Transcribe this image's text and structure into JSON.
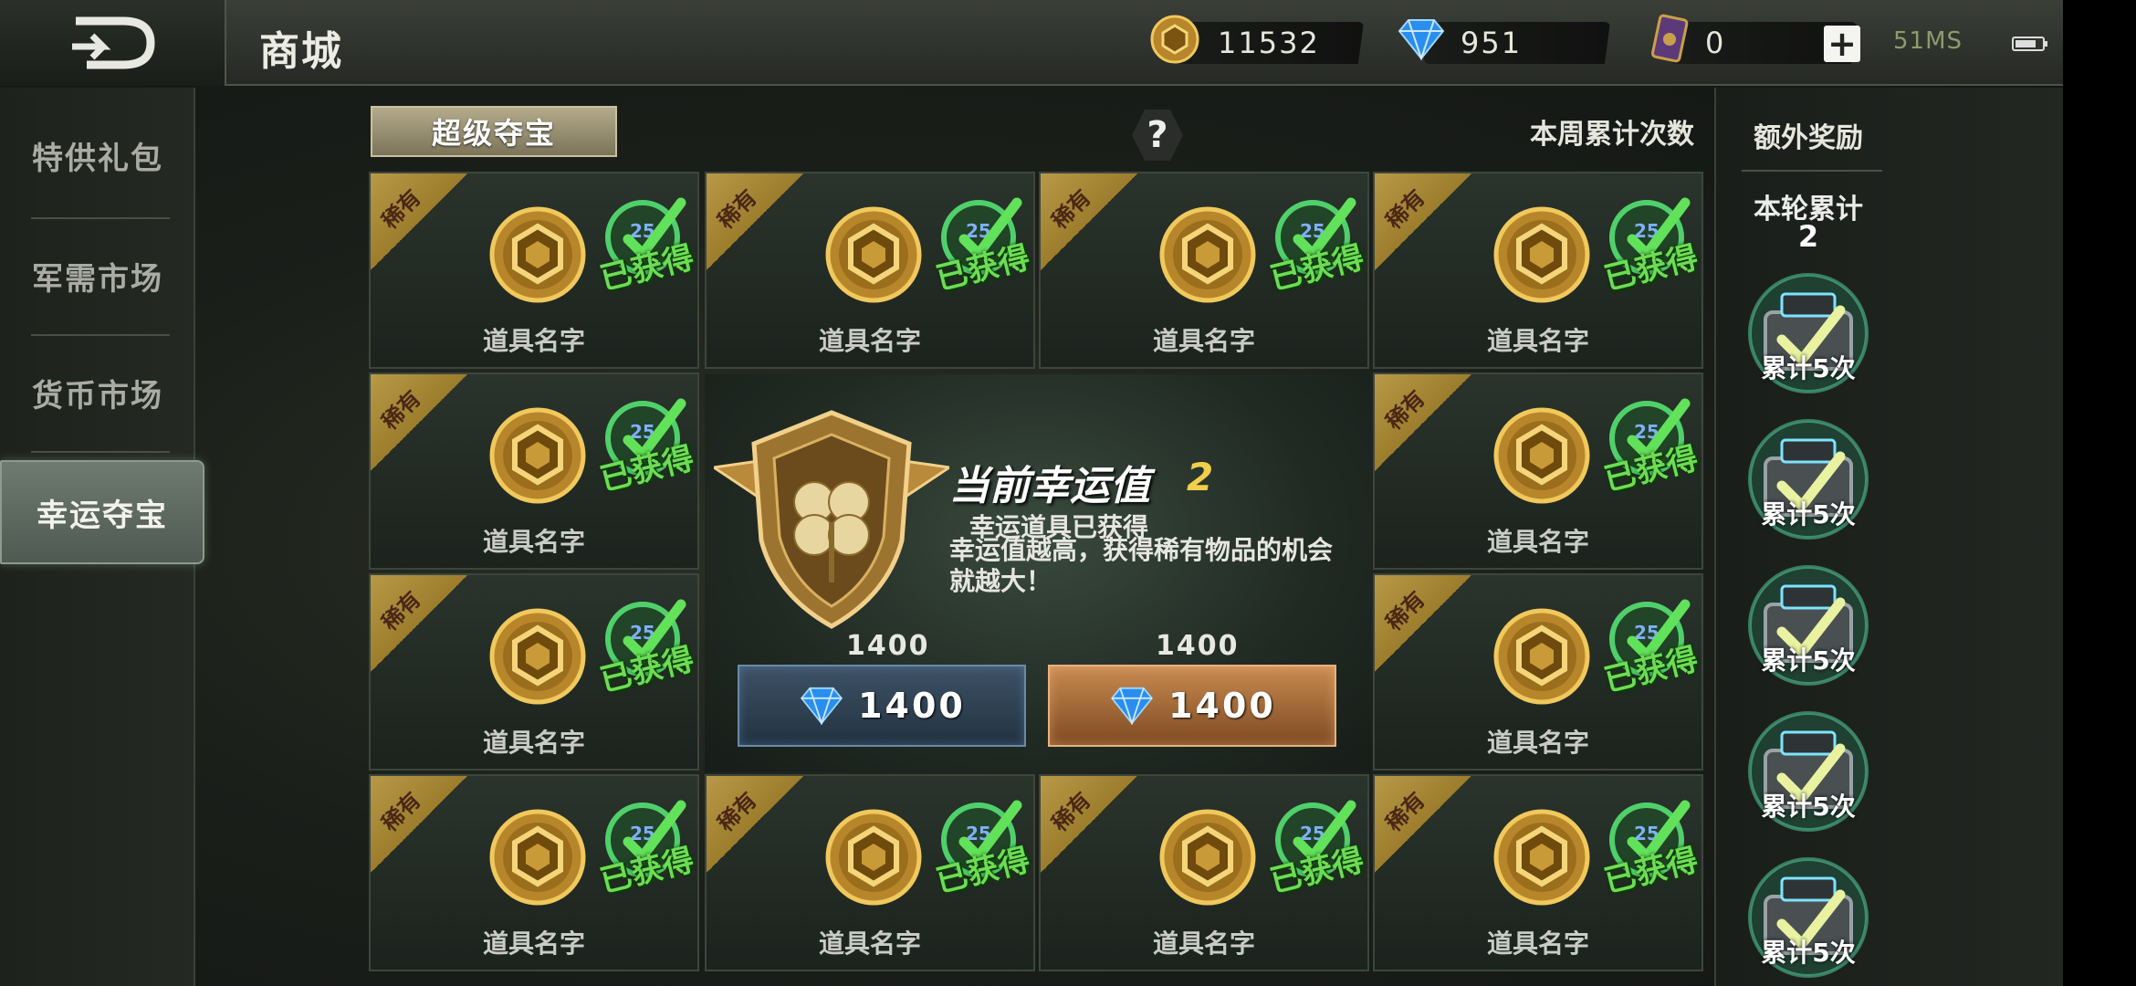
{
  "header": {
    "title": "商城",
    "back_icon": "back-arrow-icon",
    "gold": "11532",
    "diamond": "951",
    "card": "0",
    "plus": "+",
    "signal": "51MS"
  },
  "sidebar": {
    "items": [
      {
        "label": "特供礼包"
      },
      {
        "label": "军需市场"
      },
      {
        "label": "货币市场"
      },
      {
        "label": "幸运夺宝"
      }
    ],
    "active_index": 3
  },
  "main": {
    "tab": "超级夺宝",
    "help": "?",
    "week_count_label": "本周累计次数",
    "rare_label": "稀有",
    "obtained_label": "已获得",
    "item_name": "道具名字",
    "cells": [
      {
        "name": "道具名字"
      },
      {
        "name": "道具名字"
      },
      {
        "name": "道具名字"
      },
      {
        "name": "道具名字"
      },
      {
        "name": "道具名字"
      },
      {
        "name": "道具名字"
      },
      {
        "name": "道具名字"
      },
      {
        "name": "道具名字"
      },
      {
        "name": "道具名字"
      },
      {
        "name": "道具名字"
      },
      {
        "name": "道具名字"
      },
      {
        "name": "道具名字"
      }
    ],
    "center": {
      "luck_title": "当前幸运值",
      "luck_value": "2",
      "desc_line1": "幸运道具已获得",
      "desc_line2": "幸运值越高，获得稀有物品的机会就越大！",
      "single": {
        "price_label": "1400",
        "price": "1400"
      },
      "multi": {
        "price_label": "1400",
        "price": "1400"
      }
    }
  },
  "right_panel": {
    "extra_title": "额外奖励",
    "round_label": "本轮累计",
    "round_count": "2",
    "rewards": [
      {
        "label": "累计5次"
      },
      {
        "label": "累计5次"
      },
      {
        "label": "累计5次"
      },
      {
        "label": "累计5次"
      },
      {
        "label": "累计5次"
      }
    ]
  },
  "colors": {
    "accent_gold": "#c9a04a",
    "obtained_green": "#6ddc55",
    "luck_yellow": "#f0cf4a"
  }
}
